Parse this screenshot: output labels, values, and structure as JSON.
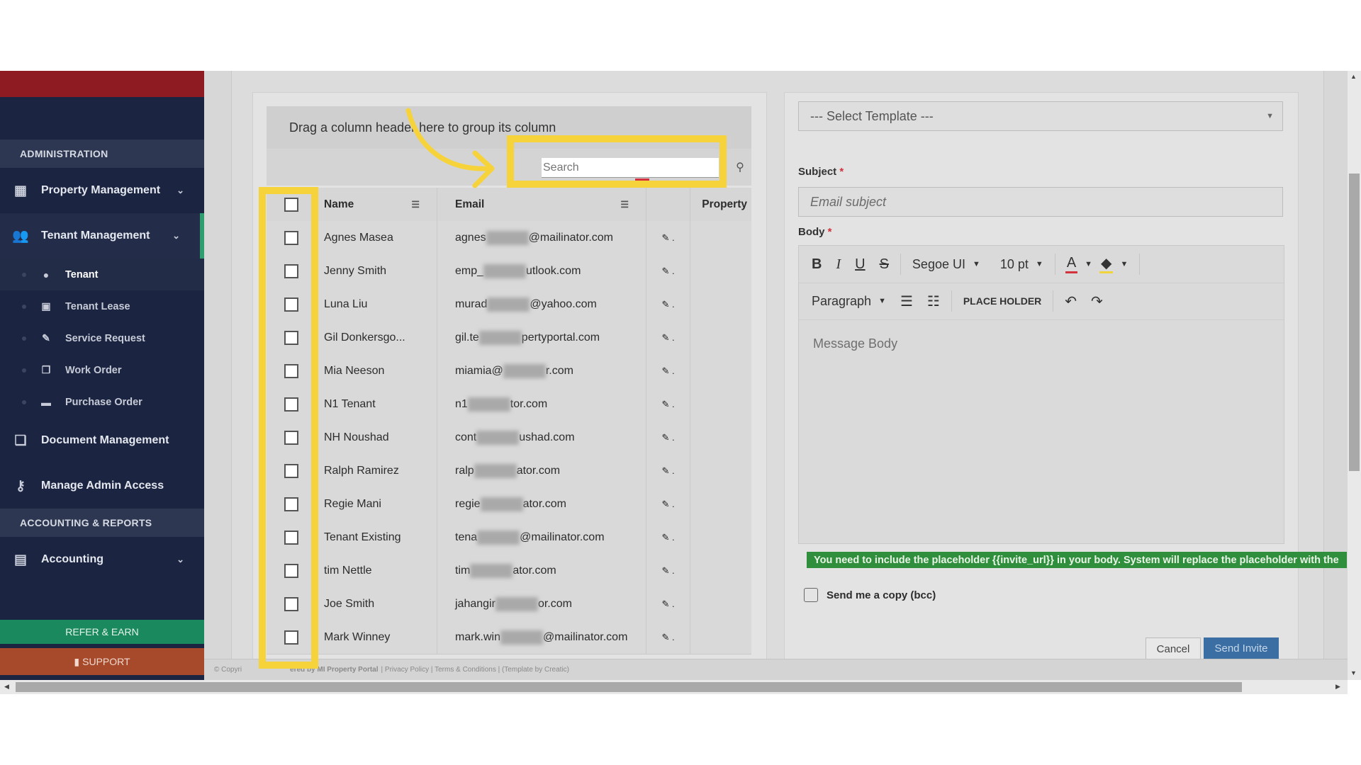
{
  "sidebar": {
    "section_admin": "ADMINISTRATION",
    "property_management": "Property Management",
    "tenant_management": "Tenant Management",
    "tenant_sub": [
      "Tenant",
      "Tenant Lease",
      "Service Request",
      "Work Order",
      "Purchase Order"
    ],
    "document_management": "Document Management",
    "manage_admin_access": "Manage Admin Access",
    "section_accounting": "ACCOUNTING & REPORTS",
    "accounting": "Accounting",
    "refer_earn": "REFER & EARN",
    "support": "SUPPORT"
  },
  "grid": {
    "group_hint": "Drag a column header here to group its column",
    "search_placeholder": "Search",
    "columns": {
      "name": "Name",
      "email": "Email",
      "property": "Property"
    },
    "rows": [
      {
        "name": "Agnes Masea",
        "email_a": "agnes",
        "email_b": "@mailinator.com"
      },
      {
        "name": "Jenny Smith",
        "email_a": "emp_",
        "email_b": "utlook.com"
      },
      {
        "name": "Luna Liu",
        "email_a": "murad",
        "email_b": "@yahoo.com"
      },
      {
        "name": "Gil Donkersgo...",
        "email_a": "gil.te",
        "email_b": "pertyportal.com"
      },
      {
        "name": "Mia Neeson",
        "email_a": "miamia@",
        "email_b": "r.com"
      },
      {
        "name": "N1 Tenant",
        "email_a": "n1",
        "email_b": "tor.com"
      },
      {
        "name": "NH Noushad",
        "email_a": "cont",
        "email_b": "ushad.com"
      },
      {
        "name": "Ralph Ramirez",
        "email_a": "ralp",
        "email_b": "ator.com"
      },
      {
        "name": "Regie Mani",
        "email_a": "regie",
        "email_b": "ator.com"
      },
      {
        "name": "Tenant Existing",
        "email_a": "tena",
        "email_b": "@mailinator.com"
      },
      {
        "name": "tim Nettle",
        "email_a": "tim",
        "email_b": "ator.com"
      },
      {
        "name": "Joe Smith",
        "email_a": "jahangir",
        "email_b": "or.com"
      },
      {
        "name": "Mark Winney",
        "email_a": "mark.win",
        "email_b": "@mailinator.com"
      }
    ]
  },
  "form": {
    "template_placeholder": "--- Select Template ---",
    "subject_label": "Subject",
    "subject_placeholder": "Email subject",
    "body_label": "Body",
    "font_family": "Segoe UI",
    "font_size": "10 pt",
    "paragraph": "Paragraph",
    "place_holder": "PLACE HOLDER",
    "message_placeholder": "Message Body",
    "notice": "You need to include the placeholder {{invite_url}} in your body. System will replace the placeholder with the",
    "bcc_label": "Send me a copy (bcc)",
    "cancel": "Cancel",
    "send": "Send Invite"
  },
  "footer": {
    "text": "© Copyri",
    "powered": "ered by MI Property Portal",
    "links": "| Privacy Policy | Terms & Conditions | (Template by Creatic)"
  },
  "colors": {
    "highlight": "#f7d33b",
    "sidebar_bg": "#1b2440",
    "notice_bg": "#2f8f3d",
    "send_bg": "#3b6fa3"
  }
}
